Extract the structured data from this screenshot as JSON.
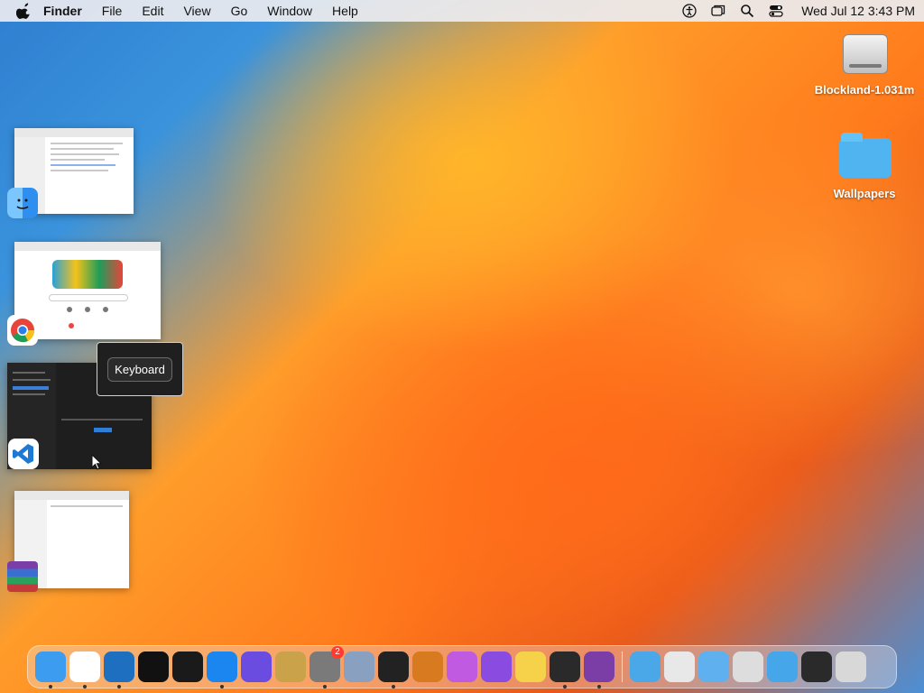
{
  "menubar": {
    "app_name": "Finder",
    "items": [
      "File",
      "Edit",
      "View",
      "Go",
      "Window",
      "Help"
    ],
    "clock": "Wed Jul 12  3:43 PM",
    "status_icons": [
      "accessibility-icon",
      "window-stack-icon",
      "search-icon",
      "control-center-icon"
    ]
  },
  "desktop": {
    "icons": [
      {
        "label": "Blockland-1.031m",
        "kind": "hard-disk-icon"
      },
      {
        "label": "Wallpapers",
        "kind": "folder-icon"
      }
    ]
  },
  "switcher": {
    "tooltip": "Keyboard",
    "apps": [
      {
        "name": "Finder",
        "icon": "finder-icon"
      },
      {
        "name": "Google Chrome",
        "icon": "chrome-icon"
      },
      {
        "name": "Visual Studio Code",
        "icon": "vscode-icon"
      },
      {
        "name": "WinRAR",
        "icon": "winrar-icon"
      }
    ]
  },
  "dock": {
    "apps": [
      {
        "icon": "finder-icon",
        "running": true,
        "color": "#3b9cf0"
      },
      {
        "icon": "chrome-icon",
        "running": true,
        "color": "#ffffff"
      },
      {
        "icon": "vscode-icon",
        "running": true,
        "color": "#1e6fc0"
      },
      {
        "icon": "capcut-icon",
        "running": false,
        "color": "#111111"
      },
      {
        "icon": "widgets-icon",
        "running": false,
        "color": "#1a1a1a"
      },
      {
        "icon": "app-store-icon",
        "running": true,
        "color": "#1b86f0"
      },
      {
        "icon": "launchpad-icon",
        "running": false,
        "color": "#6a4de0"
      },
      {
        "icon": "archive-utility-icon",
        "running": false,
        "color": "#c9a24a"
      },
      {
        "icon": "system-settings-icon",
        "running": true,
        "color": "#7a7a7a",
        "badge": "2"
      },
      {
        "icon": "xcode-tools-icon",
        "running": false,
        "color": "#8aa0c0"
      },
      {
        "icon": "terminal-icon",
        "running": true,
        "color": "#222222"
      },
      {
        "icon": "garageband-icon",
        "running": false,
        "color": "#d77a20"
      },
      {
        "icon": "shortcuts-icon",
        "running": false,
        "color": "#c05ae0"
      },
      {
        "icon": "visual-studio-icon",
        "running": false,
        "color": "#8a4be0"
      },
      {
        "icon": "notes-icon",
        "running": false,
        "color": "#f6d24a"
      },
      {
        "icon": "activity-monitor-icon",
        "running": true,
        "color": "#2a2a2a"
      },
      {
        "icon": "winrar-icon",
        "running": true,
        "color": "#7a3ea6"
      }
    ],
    "stacks": [
      {
        "icon": "applications-folder-icon",
        "color": "#4aa8e8"
      },
      {
        "icon": "document-icon",
        "color": "#e8e8e8"
      },
      {
        "icon": "documents-folder-icon",
        "color": "#5fb0ee"
      },
      {
        "icon": "printer-icon",
        "color": "#dddddd"
      },
      {
        "icon": "downloads-folder-icon",
        "color": "#46a6ea"
      },
      {
        "icon": "activity-monitor-icon",
        "color": "#2a2a2a"
      },
      {
        "icon": "trash-icon",
        "color": "#d8d8d8"
      }
    ]
  }
}
